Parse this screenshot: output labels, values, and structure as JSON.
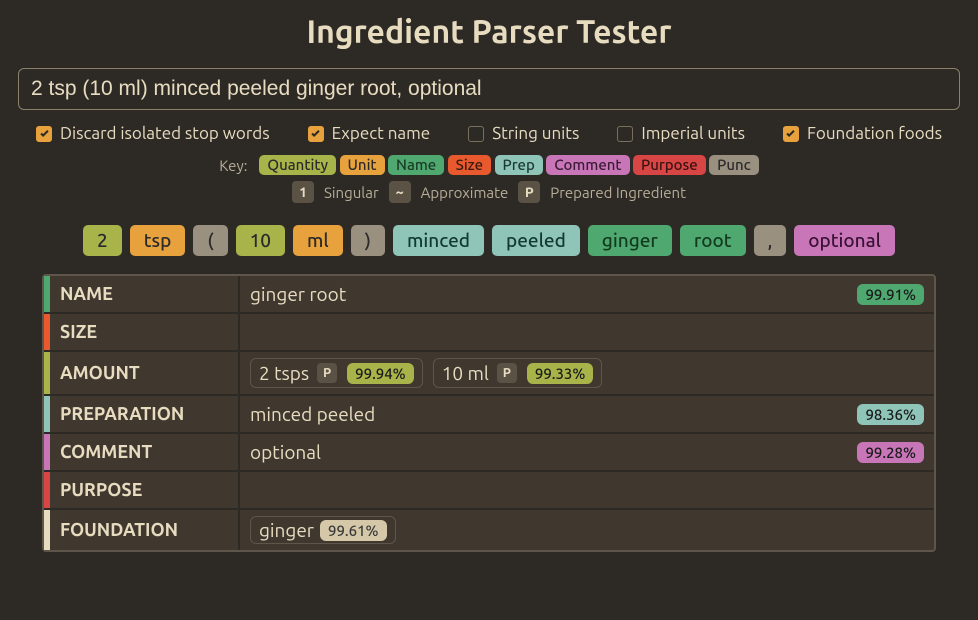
{
  "title": "Ingredient Parser Tester",
  "input": {
    "value": "2 tsp (10 ml) minced peeled ginger root, optional"
  },
  "options": [
    {
      "label": "Discard isolated stop words",
      "checked": true
    },
    {
      "label": "Expect name",
      "checked": true
    },
    {
      "label": "String units",
      "checked": false
    },
    {
      "label": "Imperial units",
      "checked": false
    },
    {
      "label": "Foundation foods",
      "checked": true
    }
  ],
  "legend": {
    "key": "Key:",
    "colors": [
      {
        "label": "Quantity",
        "cls": "quantity"
      },
      {
        "label": "Unit",
        "cls": "unit"
      },
      {
        "label": "Name",
        "cls": "name"
      },
      {
        "label": "Size",
        "cls": "size"
      },
      {
        "label": "Prep",
        "cls": "prep"
      },
      {
        "label": "Comment",
        "cls": "comment"
      },
      {
        "label": "Purpose",
        "cls": "purpose"
      },
      {
        "label": "Punc",
        "cls": "punc"
      }
    ],
    "badges": [
      {
        "sym": "1",
        "label": "Singular"
      },
      {
        "sym": "~",
        "label": "Approximate"
      },
      {
        "sym": "P",
        "label": "Prepared Ingredient"
      }
    ]
  },
  "tokens": [
    {
      "text": "2",
      "cls": "quantity"
    },
    {
      "text": "tsp",
      "cls": "unit"
    },
    {
      "text": "(",
      "cls": "punc"
    },
    {
      "text": "10",
      "cls": "quantity"
    },
    {
      "text": "ml",
      "cls": "unit"
    },
    {
      "text": ")",
      "cls": "punc"
    },
    {
      "text": "minced",
      "cls": "prep"
    },
    {
      "text": "peeled",
      "cls": "prep"
    },
    {
      "text": "ginger",
      "cls": "name"
    },
    {
      "text": "root",
      "cls": "name"
    },
    {
      "text": ",",
      "cls": "punc"
    },
    {
      "text": "optional",
      "cls": "comment"
    }
  ],
  "results": {
    "name": {
      "label": "NAME",
      "value": "ginger root",
      "pct": "99.91%",
      "stripe": "name",
      "pctcls": "name"
    },
    "size": {
      "label": "SIZE",
      "value": "",
      "stripe": "size"
    },
    "amount": {
      "label": "AMOUNT",
      "stripe": "quantity",
      "groups": [
        {
          "text": "2 tsps",
          "badge": "P",
          "pct": "99.94%"
        },
        {
          "text": "10 ml",
          "badge": "P",
          "pct": "99.33%"
        }
      ]
    },
    "preparation": {
      "label": "PREPARATION",
      "value": "minced peeled",
      "pct": "98.36%",
      "stripe": "prep",
      "pctcls": "prep"
    },
    "comment": {
      "label": "COMMENT",
      "value": "optional",
      "pct": "99.28%",
      "stripe": "comment",
      "pctcls": "comment"
    },
    "purpose": {
      "label": "PURPOSE",
      "value": "",
      "stripe": "purpose"
    },
    "foundation": {
      "label": "FOUNDATION",
      "stripe": "foundation",
      "group": {
        "text": "ginger",
        "pct": "99.61%"
      }
    }
  }
}
